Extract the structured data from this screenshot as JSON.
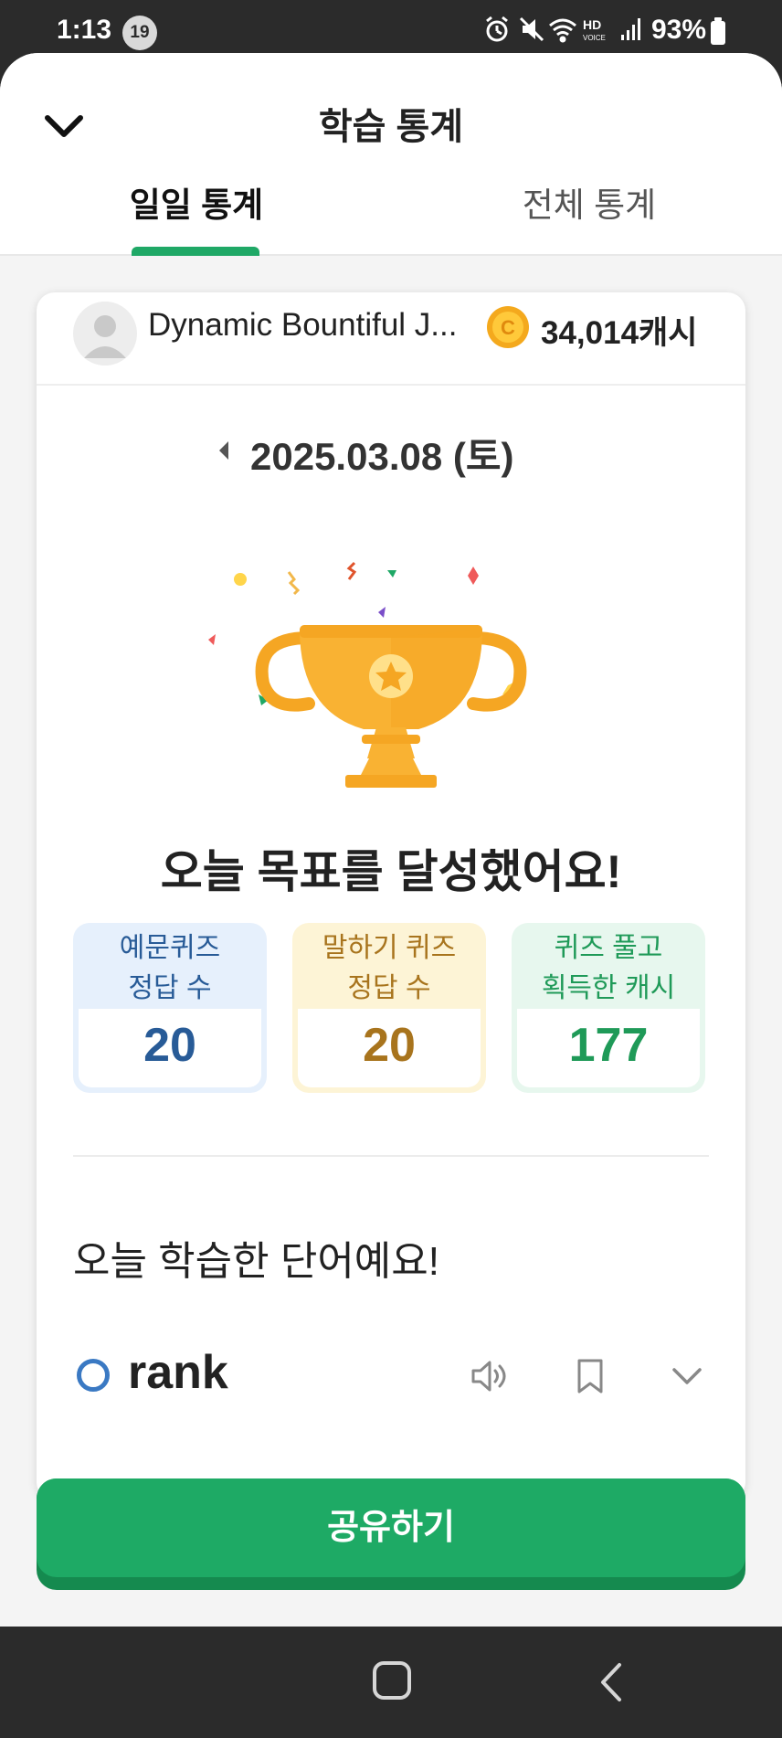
{
  "status_bar": {
    "time": "1:13",
    "notification_count": "19",
    "battery": "93%"
  },
  "header": {
    "title": "학습 통계",
    "tabs": [
      {
        "label": "일일 통계",
        "active": true
      },
      {
        "label": "전체 통계",
        "active": false
      }
    ]
  },
  "profile": {
    "name": "Dynamic Bountiful J...",
    "cash": "34,014캐시"
  },
  "date": {
    "value": "2025.03.08 (토)"
  },
  "goal_message": "오늘 목표를 달성했어요!",
  "stats": [
    {
      "label_line1": "예문퀴즈",
      "label_line2": "정답 수",
      "value": "20",
      "color": "#285b97"
    },
    {
      "label_line1": "말하기 퀴즈",
      "label_line2": "정답 수",
      "value": "20",
      "color": "#a8741d"
    },
    {
      "label_line1": "퀴즈 풀고",
      "label_line2": "획득한 캐시",
      "value": "177",
      "color": "#1f9a58"
    }
  ],
  "words_section": {
    "title": "오늘 학습한 단어예요!",
    "words": [
      {
        "word": "rank"
      }
    ]
  },
  "share_button": "공유하기",
  "colors": {
    "accent_green": "#1eaa65",
    "tab_indicator": "#1fa866",
    "word_circle": "#3a79c3",
    "trophy": "#f8b133"
  },
  "icons": [
    "chevron-down-icon",
    "coin-icon",
    "caret-left-icon",
    "trophy-icon",
    "speaker-icon",
    "bookmark-icon",
    "chevron-down-icon",
    "home-icon",
    "back-icon"
  ]
}
